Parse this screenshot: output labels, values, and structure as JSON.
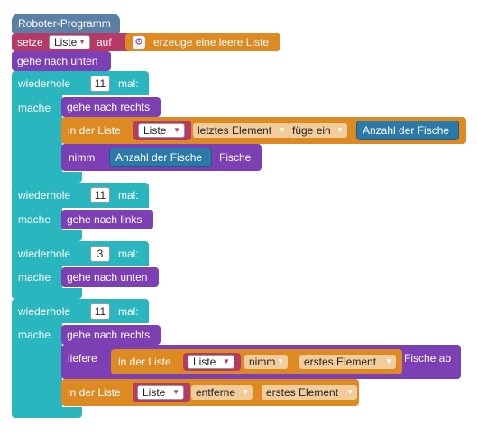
{
  "program": {
    "hat_label": "Roboter-Programm",
    "set_block": {
      "setze": "setze",
      "var": "Liste",
      "auf": "auf",
      "create_list": "erzeuge eine leere Liste"
    },
    "move_down_1": "gehe nach unten",
    "loops": [
      {
        "repeat": "wiederhole",
        "count": "11",
        "times": "mal:",
        "do": "mache",
        "move": "gehe nach rechts",
        "in_list": "in der Liste",
        "list_var": "Liste",
        "position": "letztes Element",
        "action": "füge ein",
        "value": "Anzahl der Fische",
        "take": "nimm",
        "take_value": "Anzahl der Fische",
        "take_suffix": "Fische"
      },
      {
        "repeat": "wiederhole",
        "count": "11",
        "times": "mal:",
        "do": "mache",
        "move": "gehe nach links"
      },
      {
        "repeat": "wiederhole",
        "count": "3",
        "times": "mal:",
        "do": "mache",
        "move": "gehe nach unten"
      },
      {
        "repeat": "wiederhole",
        "count": "11",
        "times": "mal:",
        "do": "mache",
        "move": "gehe nach rechts",
        "deliver": "liefere",
        "in_list": "in der Liste",
        "list_var": "Liste",
        "get_action": "nimm",
        "get_position": "erstes Element",
        "deliver_suffix": "Fische ab",
        "in_list2": "in der Liste",
        "list_var2": "Liste",
        "remove_action": "entferne",
        "remove_position": "erstes Element"
      }
    ]
  },
  "colors": {
    "hat": "#5c7fa8",
    "loop": "#29b6bf",
    "action": "#7c3fb4",
    "list": "#dd8a22",
    "variable": "#b53b64",
    "robot_value": "#2a79a8"
  },
  "icons": {
    "gear": "gear-icon",
    "dropdown": "dropdown-arrow-icon"
  }
}
